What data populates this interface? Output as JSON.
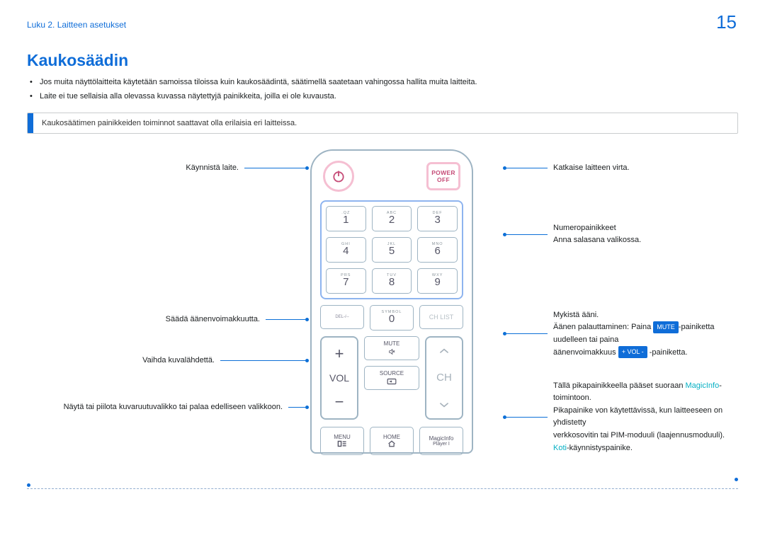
{
  "header": {
    "chapter": "Luku 2. Laitteen asetukset",
    "page_number": "15"
  },
  "section_title": "Kaukosäädin",
  "bullets": [
    "Jos muita näyttölaitteita käytetään samoissa tiloissa kuin kaukosäädintä, säätimellä saatetaan vahingossa hallita muita laitteita.",
    "Laite ei tue sellaisia alla olevassa kuvassa näytettyjä painikkeita, joilla ei ole kuvausta."
  ],
  "note": "Kaukosäätimen painikkeiden toiminnot saattavat olla erilaisia eri laitteissa.",
  "remote": {
    "power_off_top": "POWER",
    "power_off_bottom": "OFF",
    "numpad_letters": [
      ".QZ",
      "ABC",
      "DEF",
      "GHI",
      "JKL",
      "MNO",
      "PRS",
      "TUV",
      "WXY"
    ],
    "numpad_digits": [
      "1",
      "2",
      "3",
      "4",
      "5",
      "6",
      "7",
      "8",
      "9"
    ],
    "del_key": "DEL-/--",
    "symbol_top": "SYMBOL",
    "zero": "0",
    "chlist": "CH LIST",
    "vol": "VOL",
    "ch": "CH",
    "mute": "MUTE",
    "source": "SOURCE",
    "menu": "MENU",
    "home": "HOME",
    "magicinfo_top": "MagicInfo",
    "magicinfo_bottom": "Player I"
  },
  "anno": {
    "l_power_on": "Käynnistä laite.",
    "l_volume": "Säädä äänenvoimakkuutta.",
    "l_source": "Vaihda kuvalähdettä.",
    "l_menu": "Näytä tai piilota kuvaruutuvalikko tai palaa edelliseen valikkoon.",
    "r_power_off": "Katkaise laitteen virta.",
    "r_num1": "Numeropainikkeet",
    "r_num2": "Anna salasana valikossa.",
    "r_mute1": "Mykistä ääni.",
    "r_mute2_a": "Äänen palauttaminen: Paina ",
    "r_mute2_chip1": "MUTE",
    "r_mute2_b": "-painiketta uudelleen tai paina",
    "r_mute3_a": "äänenvoimakkuus ",
    "r_mute3_chip2": "+ VOL -",
    "r_mute3_b": " -painiketta.",
    "r_magic1_a": "Tällä pikapainikkeella pääset suoraan ",
    "r_magic1_kw": "MagicInfo",
    "r_magic1_b": "-toimintoon.",
    "r_magic2": "Pikapainike von käytettävissä, kun laitteeseen on yhdistetty",
    "r_magic3": "verkkosovitin tai PIM-moduuli (laajennusmoduuli).",
    "r_home_kw": "Koti",
    "r_home_b": "-käynnistyspainike."
  }
}
